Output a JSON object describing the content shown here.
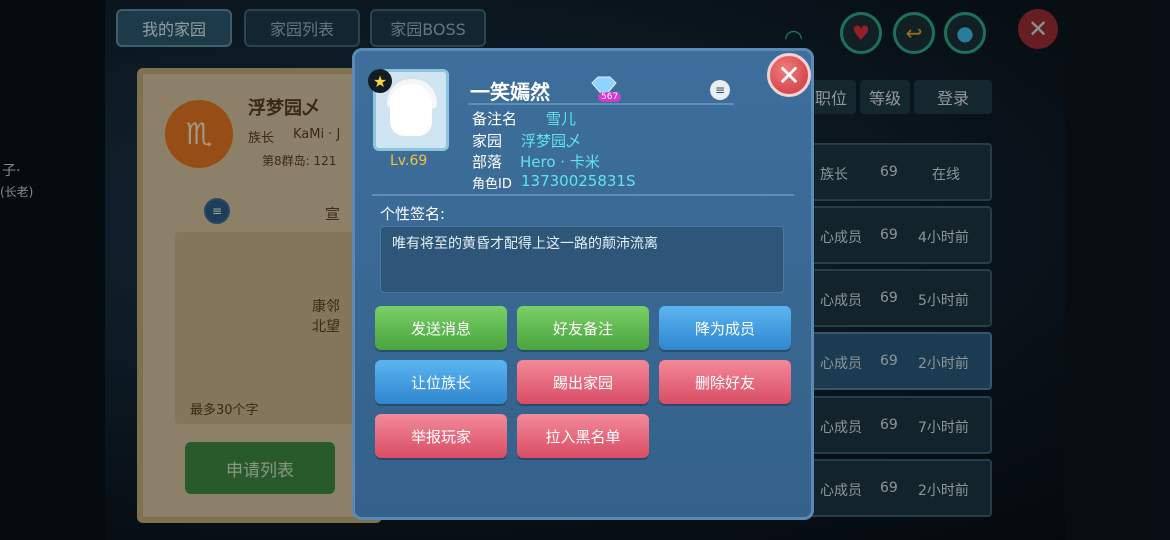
{
  "tabs": [
    "我的家园",
    "家园列表",
    "家园BOSS"
  ],
  "home_panel": {
    "name": "浮梦园乄",
    "leader_label": "族长",
    "leader_value": "KaMi · J",
    "island": "第8群岛: 121",
    "notice_label": "宣",
    "notice_body_1": "康邻",
    "notice_body_2": "北望",
    "char_limit": "最多30个字",
    "apply_list": "申请列表"
  },
  "left_edge": {
    "line1": "子·",
    "line2": "(长老)"
  },
  "member_list": {
    "headers": [
      "职位",
      "等级",
      "登录"
    ],
    "rows": [
      {
        "role": "族长",
        "level": "69",
        "login": "在线"
      },
      {
        "role": "心成员",
        "level": "69",
        "login": "4小时前"
      },
      {
        "role": "心成员",
        "level": "69",
        "login": "5小时前"
      },
      {
        "role": "心成员",
        "level": "69",
        "login": "2小时前"
      },
      {
        "role": "心成员",
        "level": "69",
        "login": "7小时前"
      },
      {
        "role": "心成员",
        "level": "69",
        "login": "2小时前"
      }
    ]
  },
  "profile": {
    "name": "一笑嫣然",
    "level": "Lv.69",
    "gem_count": "567",
    "remark_label": "备注名",
    "remark_value": "雪儿",
    "home_label": "家园",
    "home_value": "浮梦园乄",
    "tribe_label": "部落",
    "tribe_value": "Hero · 卡米",
    "id_label": "角色ID",
    "id_value": "13730025831S",
    "signature_label": "个性签名:",
    "signature": "唯有将至的黄昏才配得上这一路的颠沛流离"
  },
  "actions": [
    "发送消息",
    "好友备注",
    "降为成员",
    "让位族长",
    "踢出家园",
    "删除好友",
    "举报玩家",
    "拉入黑名单"
  ],
  "icons": {
    "status": [
      "wifi-icon",
      "heart-icon",
      "return-icon",
      "water-drop-icon"
    ],
    "close": "close-icon"
  },
  "colors": {
    "dialog": "#3a6a95",
    "green_button": "#5cb84c",
    "blue_button": "#3a92d8",
    "red_button": "#e0607a",
    "accent_cyan": "#5fe6ec"
  }
}
